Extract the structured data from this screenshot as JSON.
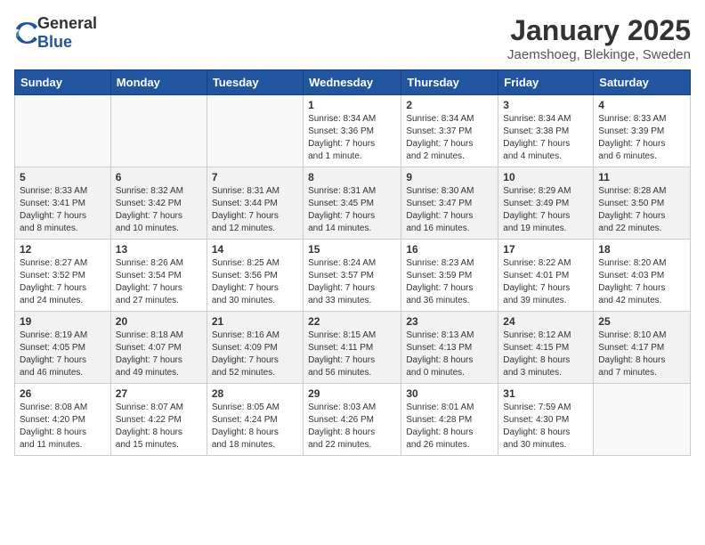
{
  "header": {
    "logo_general": "General",
    "logo_blue": "Blue",
    "month": "January 2025",
    "location": "Jaemshoeg, Blekinge, Sweden"
  },
  "weekdays": [
    "Sunday",
    "Monday",
    "Tuesday",
    "Wednesday",
    "Thursday",
    "Friday",
    "Saturday"
  ],
  "weeks": [
    [
      {
        "day": "",
        "info": ""
      },
      {
        "day": "",
        "info": ""
      },
      {
        "day": "",
        "info": ""
      },
      {
        "day": "1",
        "info": "Sunrise: 8:34 AM\nSunset: 3:36 PM\nDaylight: 7 hours\nand 1 minute."
      },
      {
        "day": "2",
        "info": "Sunrise: 8:34 AM\nSunset: 3:37 PM\nDaylight: 7 hours\nand 2 minutes."
      },
      {
        "day": "3",
        "info": "Sunrise: 8:34 AM\nSunset: 3:38 PM\nDaylight: 7 hours\nand 4 minutes."
      },
      {
        "day": "4",
        "info": "Sunrise: 8:33 AM\nSunset: 3:39 PM\nDaylight: 7 hours\nand 6 minutes."
      }
    ],
    [
      {
        "day": "5",
        "info": "Sunrise: 8:33 AM\nSunset: 3:41 PM\nDaylight: 7 hours\nand 8 minutes."
      },
      {
        "day": "6",
        "info": "Sunrise: 8:32 AM\nSunset: 3:42 PM\nDaylight: 7 hours\nand 10 minutes."
      },
      {
        "day": "7",
        "info": "Sunrise: 8:31 AM\nSunset: 3:44 PM\nDaylight: 7 hours\nand 12 minutes."
      },
      {
        "day": "8",
        "info": "Sunrise: 8:31 AM\nSunset: 3:45 PM\nDaylight: 7 hours\nand 14 minutes."
      },
      {
        "day": "9",
        "info": "Sunrise: 8:30 AM\nSunset: 3:47 PM\nDaylight: 7 hours\nand 16 minutes."
      },
      {
        "day": "10",
        "info": "Sunrise: 8:29 AM\nSunset: 3:49 PM\nDaylight: 7 hours\nand 19 minutes."
      },
      {
        "day": "11",
        "info": "Sunrise: 8:28 AM\nSunset: 3:50 PM\nDaylight: 7 hours\nand 22 minutes."
      }
    ],
    [
      {
        "day": "12",
        "info": "Sunrise: 8:27 AM\nSunset: 3:52 PM\nDaylight: 7 hours\nand 24 minutes."
      },
      {
        "day": "13",
        "info": "Sunrise: 8:26 AM\nSunset: 3:54 PM\nDaylight: 7 hours\nand 27 minutes."
      },
      {
        "day": "14",
        "info": "Sunrise: 8:25 AM\nSunset: 3:56 PM\nDaylight: 7 hours\nand 30 minutes."
      },
      {
        "day": "15",
        "info": "Sunrise: 8:24 AM\nSunset: 3:57 PM\nDaylight: 7 hours\nand 33 minutes."
      },
      {
        "day": "16",
        "info": "Sunrise: 8:23 AM\nSunset: 3:59 PM\nDaylight: 7 hours\nand 36 minutes."
      },
      {
        "day": "17",
        "info": "Sunrise: 8:22 AM\nSunset: 4:01 PM\nDaylight: 7 hours\nand 39 minutes."
      },
      {
        "day": "18",
        "info": "Sunrise: 8:20 AM\nSunset: 4:03 PM\nDaylight: 7 hours\nand 42 minutes."
      }
    ],
    [
      {
        "day": "19",
        "info": "Sunrise: 8:19 AM\nSunset: 4:05 PM\nDaylight: 7 hours\nand 46 minutes."
      },
      {
        "day": "20",
        "info": "Sunrise: 8:18 AM\nSunset: 4:07 PM\nDaylight: 7 hours\nand 49 minutes."
      },
      {
        "day": "21",
        "info": "Sunrise: 8:16 AM\nSunset: 4:09 PM\nDaylight: 7 hours\nand 52 minutes."
      },
      {
        "day": "22",
        "info": "Sunrise: 8:15 AM\nSunset: 4:11 PM\nDaylight: 7 hours\nand 56 minutes."
      },
      {
        "day": "23",
        "info": "Sunrise: 8:13 AM\nSunset: 4:13 PM\nDaylight: 8 hours\nand 0 minutes."
      },
      {
        "day": "24",
        "info": "Sunrise: 8:12 AM\nSunset: 4:15 PM\nDaylight: 8 hours\nand 3 minutes."
      },
      {
        "day": "25",
        "info": "Sunrise: 8:10 AM\nSunset: 4:17 PM\nDaylight: 8 hours\nand 7 minutes."
      }
    ],
    [
      {
        "day": "26",
        "info": "Sunrise: 8:08 AM\nSunset: 4:20 PM\nDaylight: 8 hours\nand 11 minutes."
      },
      {
        "day": "27",
        "info": "Sunrise: 8:07 AM\nSunset: 4:22 PM\nDaylight: 8 hours\nand 15 minutes."
      },
      {
        "day": "28",
        "info": "Sunrise: 8:05 AM\nSunset: 4:24 PM\nDaylight: 8 hours\nand 18 minutes."
      },
      {
        "day": "29",
        "info": "Sunrise: 8:03 AM\nSunset: 4:26 PM\nDaylight: 8 hours\nand 22 minutes."
      },
      {
        "day": "30",
        "info": "Sunrise: 8:01 AM\nSunset: 4:28 PM\nDaylight: 8 hours\nand 26 minutes."
      },
      {
        "day": "31",
        "info": "Sunrise: 7:59 AM\nSunset: 4:30 PM\nDaylight: 8 hours\nand 30 minutes."
      },
      {
        "day": "",
        "info": ""
      }
    ]
  ]
}
